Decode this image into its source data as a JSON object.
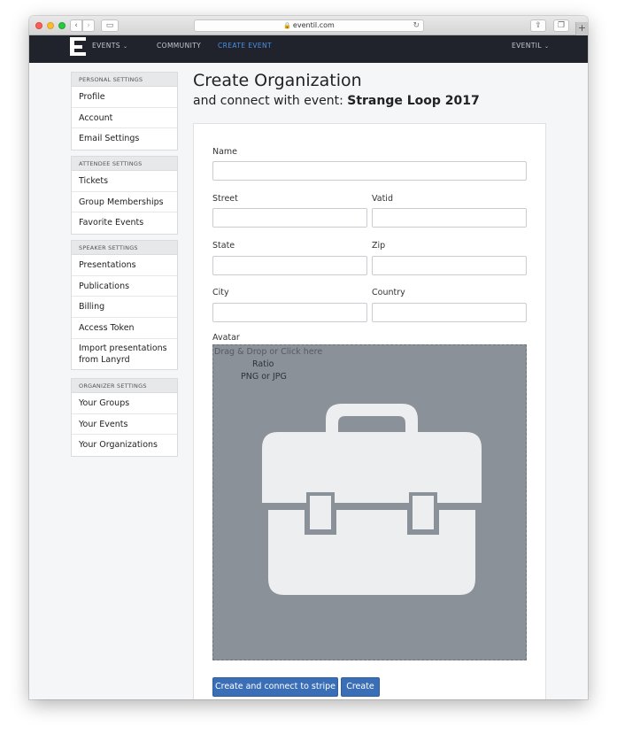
{
  "browser": {
    "url": "eventil.com",
    "nav_back": "‹",
    "nav_forward": "›",
    "sidebar_icon": "▭",
    "share_icon": "⇪",
    "tabs_icon": "❐",
    "reload_icon": "↻",
    "lock_icon": "🔒",
    "new_tab": "+"
  },
  "topnav": {
    "logo": "E",
    "events": "EVENTS",
    "community": "COMMUNITY",
    "create_event": "CREATE EVENT",
    "account": "EVENTIL",
    "chevron": "⌄",
    "active_color": "#4a90e2",
    "bg_color": "#20232b"
  },
  "sidebar": {
    "personal": {
      "header": "PERSONAL SETTINGS",
      "items": [
        "Profile",
        "Account",
        "Email Settings"
      ]
    },
    "attendee": {
      "header": "ATTENDEE SETTINGS",
      "items": [
        "Tickets",
        "Group Memberships",
        "Favorite Events"
      ]
    },
    "speaker": {
      "header": "SPEAKER SETTINGS",
      "items": [
        "Presentations",
        "Publications",
        "Billing",
        "Access Token",
        "Import presentations from Lanyrd"
      ]
    },
    "organizer": {
      "header": "ORGANIZER SETTINGS",
      "items": [
        "Your Groups",
        "Your Events",
        "Your Organizations"
      ]
    }
  },
  "main": {
    "title": "Create Organization",
    "subtitle_prefix": "and connect with event: ",
    "event_name": "Strange Loop 2017"
  },
  "form": {
    "name_label": "Name",
    "name_value": "",
    "street_label": "Street",
    "street_value": "",
    "vatid_label": "Vatid",
    "vatid_value": "",
    "state_label": "State",
    "state_value": "",
    "zip_label": "Zip",
    "zip_value": "",
    "city_label": "City",
    "city_value": "",
    "country_label": "Country",
    "country_value": "",
    "avatar_label": "Avatar",
    "drop_hint": "Drag & Drop or Click here",
    "ratio_hint": "Ratio",
    "format_hint": "PNG or JPG",
    "placeholder_icon": "briefcase-icon"
  },
  "actions": {
    "create_connect_stripe": "Create and connect to stripe",
    "create": "Create",
    "button_color": "#3a6fb7"
  }
}
